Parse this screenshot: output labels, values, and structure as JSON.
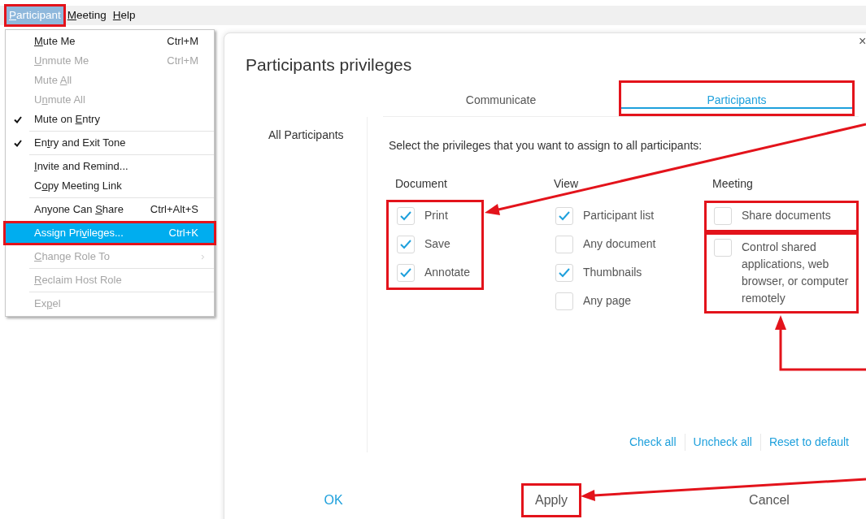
{
  "menubar": [
    {
      "label": {
        "key": "P",
        "after": "articipant"
      },
      "selected": true,
      "highlighted": true
    },
    {
      "label": {
        "key": "M",
        "after": "eeting"
      },
      "selected": false,
      "highlighted": false
    },
    {
      "label": {
        "key": "H",
        "after": "elp"
      },
      "selected": false,
      "highlighted": false
    }
  ],
  "menu": [
    {
      "kind": "item",
      "label": {
        "key": "M",
        "after": "ute Me"
      },
      "shortcut": "Ctrl+M",
      "disabled": false,
      "checked": false,
      "selected": false,
      "highlighted": false
    },
    {
      "kind": "item",
      "label": {
        "key": "U",
        "after": "nmute Me"
      },
      "shortcut": "Ctrl+M",
      "disabled": true,
      "checked": false,
      "selected": false,
      "highlighted": false
    },
    {
      "kind": "item",
      "label": {
        "before": "Mute ",
        "key": "A",
        "after": "ll"
      },
      "disabled": true,
      "checked": false,
      "selected": false,
      "highlighted": false
    },
    {
      "kind": "item",
      "label": {
        "before": "U",
        "key": "n",
        "after": "mute All"
      },
      "disabled": true,
      "checked": false,
      "selected": false,
      "highlighted": false
    },
    {
      "kind": "item",
      "label": {
        "before": "Mute on ",
        "key": "E",
        "after": "ntry"
      },
      "disabled": false,
      "checked": true,
      "selected": false,
      "highlighted": false
    },
    {
      "kind": "separator"
    },
    {
      "kind": "item",
      "label": {
        "before": "En",
        "key": "t",
        "after": "ry and Exit Tone"
      },
      "disabled": false,
      "checked": true,
      "selected": false,
      "highlighted": false
    },
    {
      "kind": "separator"
    },
    {
      "kind": "item",
      "label": {
        "key": "I",
        "after": "nvite and Remind..."
      },
      "disabled": false,
      "checked": false,
      "selected": false,
      "highlighted": false
    },
    {
      "kind": "item",
      "label": {
        "before": "C",
        "key": "o",
        "after": "py Meeting Link"
      },
      "disabled": false,
      "checked": false,
      "selected": false,
      "highlighted": false
    },
    {
      "kind": "separator"
    },
    {
      "kind": "item",
      "label": {
        "before": "Anyone Can ",
        "key": "S",
        "after": "hare"
      },
      "shortcut": "Ctrl+Alt+S",
      "disabled": false,
      "checked": false,
      "selected": false,
      "highlighted": false
    },
    {
      "kind": "separator"
    },
    {
      "kind": "item",
      "label": {
        "before": "Assign Pri",
        "key": "v",
        "after": "ileges..."
      },
      "shortcut": "Ctrl+K",
      "disabled": false,
      "checked": false,
      "selected": true,
      "highlighted": true
    },
    {
      "kind": "separator"
    },
    {
      "kind": "submenu",
      "label": {
        "key": "C",
        "after": "hange Role To"
      },
      "disabled": true,
      "checked": false,
      "selected": false,
      "highlighted": false
    },
    {
      "kind": "separator"
    },
    {
      "kind": "item",
      "label": {
        "key": "R",
        "after": "eclaim Host Role"
      },
      "disabled": true,
      "checked": false,
      "selected": false,
      "highlighted": false
    },
    {
      "kind": "separator"
    },
    {
      "kind": "item",
      "label": {
        "before": "Ex",
        "key": "p",
        "after": "el"
      },
      "disabled": true,
      "checked": false,
      "selected": false,
      "highlighted": false
    }
  ],
  "dialog": {
    "title": "Participants privileges",
    "close": "×",
    "sidebar": [
      "All Participants"
    ],
    "tabs": [
      {
        "label": "Communicate",
        "selected": false,
        "highlighted": false
      },
      {
        "label": "Participants",
        "selected": true,
        "highlighted": true
      }
    ],
    "prompt": "Select the privileges that you want to assign to all participants:",
    "columns": [
      {
        "heading": "Document",
        "highlighted": true,
        "options": [
          {
            "label": "Print",
            "checked": true,
            "highlighted": false
          },
          {
            "label": "Save",
            "checked": true,
            "highlighted": false
          },
          {
            "label": "Annotate",
            "checked": true,
            "highlighted": false
          }
        ]
      },
      {
        "heading": "View",
        "highlighted": false,
        "options": [
          {
            "label": "Participant list",
            "checked": true,
            "highlighted": false
          },
          {
            "label": "Any document",
            "checked": false,
            "highlighted": false
          },
          {
            "label": "Thumbnails",
            "checked": true,
            "highlighted": false
          },
          {
            "label": "Any page",
            "checked": false,
            "highlighted": false
          }
        ]
      },
      {
        "heading": "Meeting",
        "highlighted": false,
        "options": [
          {
            "label": "Share documents",
            "checked": false,
            "highlighted": true
          },
          {
            "label": "Control shared applications, web browser, or computer remotely",
            "checked": false,
            "highlighted": true
          }
        ]
      }
    ],
    "links": [
      "Check all",
      "Uncheck all",
      "Reset to default"
    ],
    "buttons": [
      {
        "label": "OK",
        "kind": "primary",
        "highlighted": false
      },
      {
        "label": "Apply",
        "kind": "normal",
        "highlighted": true
      },
      {
        "label": "Cancel",
        "kind": "normal",
        "highlighted": false
      }
    ]
  }
}
